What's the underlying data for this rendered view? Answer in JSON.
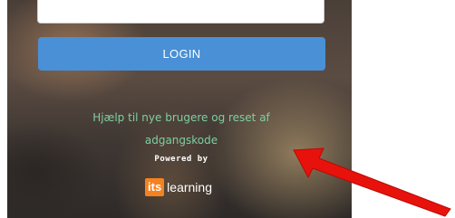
{
  "login": {
    "button_label": "LOGIN"
  },
  "help": {
    "link_text": "Hjælp til nye brugere og reset af adgangskode"
  },
  "footer": {
    "powered_by": "Powered by",
    "logo_its": "its",
    "logo_learning": "learning"
  },
  "colors": {
    "button": "#4a90d6",
    "help_link": "#7ecfa0",
    "logo_accent": "#f58220",
    "arrow": "#e8120c"
  },
  "annotation": {
    "icon": "red-arrow-icon"
  }
}
